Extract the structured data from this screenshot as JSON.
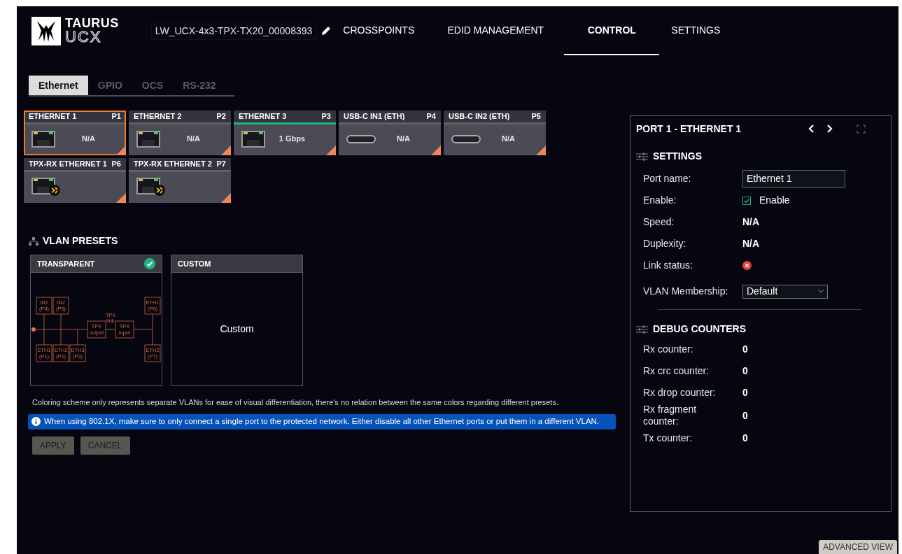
{
  "header": {
    "logo_top": "TAURUS",
    "logo_bottom": "UCX",
    "device_name": "LW_UCX-4x3-TPX-TX20_00008393",
    "nav": [
      {
        "label": "CROSSPOINTS",
        "selected": false
      },
      {
        "label": "EDID MANAGEMENT",
        "selected": false
      },
      {
        "label": "CONTROL",
        "selected": true
      },
      {
        "label": "SETTINGS",
        "selected": false
      }
    ]
  },
  "subtabs": [
    {
      "label": "Ethernet",
      "selected": true
    },
    {
      "label": "GPIO",
      "selected": false
    },
    {
      "label": "OCS",
      "selected": false
    },
    {
      "label": "RS-232",
      "selected": false
    }
  ],
  "ports": [
    {
      "name": "ETHERNET 1",
      "port": "P1",
      "kind": "rj45",
      "speed": "N/A",
      "selected": true,
      "link": false
    },
    {
      "name": "ETHERNET 2",
      "port": "P2",
      "kind": "rj45",
      "speed": "N/A",
      "selected": false,
      "link": false
    },
    {
      "name": "ETHERNET 3",
      "port": "P3",
      "kind": "rj45",
      "speed": "1 Gbps",
      "selected": false,
      "link": true
    },
    {
      "name": "USB-C IN1 (ETH)",
      "port": "P4",
      "kind": "usbc",
      "speed": "N/A",
      "selected": false,
      "link": false
    },
    {
      "name": "USB-C IN2 (ETH)",
      "port": "P5",
      "kind": "usbc",
      "speed": "N/A",
      "selected": false,
      "link": false
    },
    {
      "name": "TPX-RX ETHERNET 1",
      "port": "P6",
      "kind": "tpx",
      "selected": false,
      "link": false
    },
    {
      "name": "TPX-RX ETHERNET 2",
      "port": "P7",
      "kind": "tpx",
      "selected": false,
      "link": false
    }
  ],
  "vlan_presets": {
    "title": "VLAN PRESETS",
    "presets": [
      {
        "name": "TRANSPARENT",
        "kind": "diagram",
        "selected": true,
        "diagram_labels": [
          "IN1 (P4)",
          "IN2 (P5)",
          "ETH1 (P1)",
          "ETH2 (P2)",
          "ETH3 (P3)",
          "TPX output",
          "TPX link",
          "TPX input",
          "ETH1 (P6)",
          "ETH2 (P7)"
        ]
      },
      {
        "name": "CUSTOM",
        "kind": "text",
        "selected": false,
        "body": "Custom"
      }
    ],
    "note": "Coloring scheme only represents separate VLANs for ease of visual differentiation, there's no relation between the same colors regarding different presets.",
    "info": "When using 802.1X, make sure to only connect a single port to the protected network. Either disable all other Ethernet ports or put them in a different VLAN.",
    "buttons": [
      "APPLY",
      "CANCEL"
    ]
  },
  "panel": {
    "title": "PORT 1 - ETHERNET 1",
    "settings_title": "SETTINGS",
    "settings": [
      {
        "label": "Port name:",
        "kind": "field",
        "value": "Ethernet 1"
      },
      {
        "label": "Enable:",
        "kind": "checkbox",
        "value": "Enable",
        "checked": true
      },
      {
        "label": "Speed:",
        "kind": "text",
        "value": "N/A"
      },
      {
        "label": "Duplexity:",
        "kind": "text",
        "value": "N/A"
      },
      {
        "label": "Link status:",
        "kind": "status",
        "ok": false
      },
      {
        "label": "VLAN Membership:",
        "kind": "select",
        "value": "Default"
      }
    ],
    "debug_title": "DEBUG COUNTERS",
    "counters": [
      {
        "label": "Rx counter:",
        "value": "0"
      },
      {
        "label": "Rx crc counter:",
        "value": "0"
      },
      {
        "label": "Rx drop counter:",
        "value": "0"
      },
      {
        "label": "Rx fragment counter:",
        "value": "0"
      },
      {
        "label": "Tx counter:",
        "value": "0"
      }
    ]
  },
  "advanced_view": "ADVANCED VIEW"
}
